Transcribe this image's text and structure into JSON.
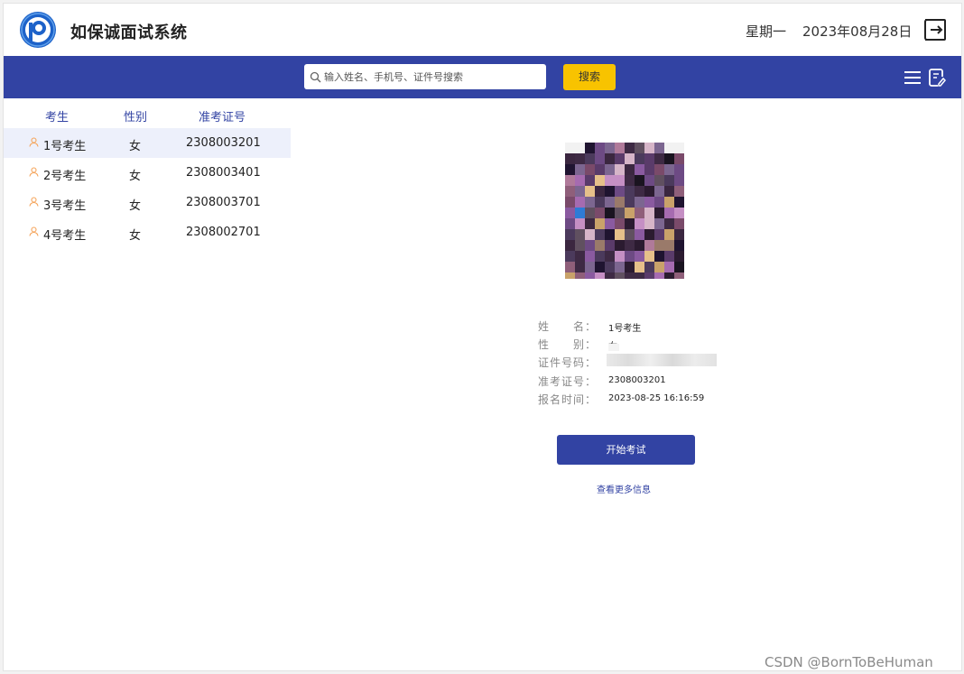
{
  "header": {
    "app_title": "如保诚面试系统",
    "weekday": "星期一",
    "date": "2023年08月28日"
  },
  "toolbar": {
    "search_placeholder": "输入姓名、手机号、证件号搜索",
    "search_value": "",
    "search_label": "搜索"
  },
  "candidate_list": {
    "columns": [
      "考生",
      "性别",
      "准考证号"
    ],
    "rows": [
      {
        "name": "1号考生",
        "gender": "女",
        "ticket": "2308003201",
        "selected": true
      },
      {
        "name": "2号考生",
        "gender": "女",
        "ticket": "2308003401",
        "selected": false
      },
      {
        "name": "3号考生",
        "gender": "女",
        "ticket": "2308003701",
        "selected": false
      },
      {
        "name": "4号考生",
        "gender": "女",
        "ticket": "2308002701",
        "selected": false
      }
    ]
  },
  "detail": {
    "name_label": "姓　　名：",
    "name": "1号考生",
    "gender_label": "性　　别：",
    "gender": "女",
    "id_label": "证件号码：",
    "ticket_label": "准考证号：",
    "ticket": "2308003201",
    "time_label": "报名时间：",
    "time": "2023-08-25 16:16:59",
    "start_label": "开始考试",
    "more_label": "查看更多信息"
  },
  "colors": {
    "primary": "#3243a3",
    "search_button": "#f8c300",
    "selected_row": "#edf0fb",
    "person_icon": "#f5a45a"
  },
  "icons": [
    "logo-icon",
    "logout-icon",
    "search-icon",
    "menu-icon",
    "notes-icon",
    "person-icon"
  ],
  "watermark": "CSDN @BornToBeHuman"
}
